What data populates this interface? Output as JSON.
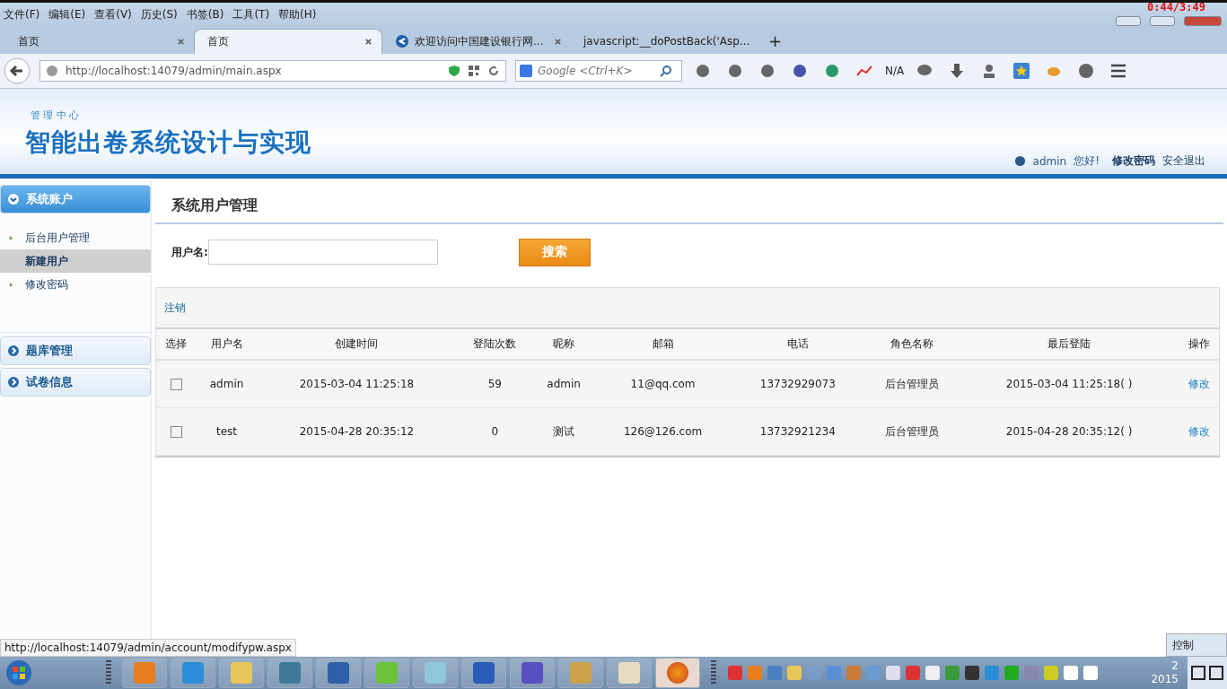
{
  "menu": [
    "文件(F)",
    "编辑(E)",
    "查看(V)",
    "历史(S)",
    "书签(B)",
    "工具(T)",
    "帮助(H)"
  ],
  "recording_timer": "0:44/3:49",
  "tabs": [
    {
      "label": "首页",
      "selected": false,
      "kind": "plain"
    },
    {
      "label": "首页",
      "selected": true,
      "kind": "plain"
    },
    {
      "label": "欢迎访问中国建设银行网...",
      "selected": false,
      "kind": "site"
    },
    {
      "label": "javascript:__doPostBack('Asp...",
      "selected": false,
      "kind": "plain"
    }
  ],
  "new_tab": "+",
  "address": "http://localhost:14079/admin/main.aspx",
  "search": {
    "placeholder": "Google <Ctrl+K>"
  },
  "toolbar_text": "N/A",
  "header": {
    "subtitle": "管 理 中 心",
    "title": "智能出卷系统设计与实现",
    "user": "admin",
    "greeting": "您好!",
    "links": [
      "修改密码",
      "安全退出"
    ]
  },
  "sidebar": [
    {
      "title": "系统账户",
      "expanded": true,
      "items": [
        {
          "label": "后台用户管理",
          "selected": false
        },
        {
          "label": "新建用户",
          "selected": true
        },
        {
          "label": "修改密码",
          "selected": false
        }
      ]
    },
    {
      "title": "题库管理",
      "expanded": false
    },
    {
      "title": "试卷信息",
      "expanded": false
    }
  ],
  "page_title": "系统用户管理",
  "filter": {
    "label": "用户名:",
    "button": "搜索"
  },
  "action": "注销",
  "table": {
    "select_column": "选择",
    "columns": [
      "用户名",
      "创建时间",
      "登陆次数",
      "昵称",
      "邮箱",
      "电话",
      "角色名称",
      "最后登陆",
      "操作"
    ],
    "rows": [
      {
        "checked": false,
        "cells": [
          "admin",
          "2015-03-04 11:25:18",
          "59",
          "admin",
          "11@qq.com",
          "13732929073",
          "后台管理员",
          "2015-03-04 11:25:18( )"
        ],
        "link": "修改"
      },
      {
        "checked": false,
        "cells": [
          "test",
          "2015-04-28 20:35:12",
          "0",
          "测试",
          "126@126.com",
          "13732921234",
          "后台管理员",
          "2015-04-28 20:35:12( )"
        ],
        "link": "修改"
      }
    ]
  },
  "status_url": "http://localhost:14079/admin/account/modifypw.aspx",
  "taskbar": {
    "clock": [
      "2",
      "2015"
    ],
    "control_panel": "控制"
  }
}
